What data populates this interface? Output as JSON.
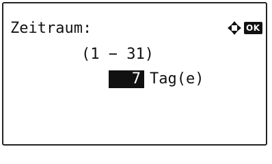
{
  "screen": {
    "title": "Zeitraum:",
    "range_text": "(1 − 31)",
    "value": "7",
    "unit": "Tag(e)",
    "ok_label": "OK",
    "nav_icon": "four-way-arrows-icon"
  }
}
